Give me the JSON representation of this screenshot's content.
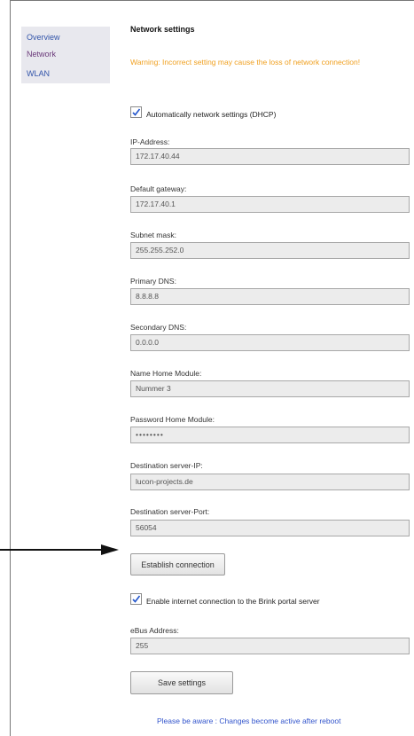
{
  "sidebar": {
    "items": [
      {
        "label": "Overview"
      },
      {
        "label": "Network"
      },
      {
        "label": "WLAN"
      }
    ]
  },
  "page": {
    "title": "Network settings",
    "warning": "Warning: Incorrect setting may cause the loss of network connection!"
  },
  "dhcp": {
    "label": "Automatically network settings (DHCP)",
    "checked": true
  },
  "fields": {
    "ip": {
      "label": "IP-Address:",
      "value": "172.17.40.44"
    },
    "gateway": {
      "label": "Default gateway:",
      "value": "172.17.40.1"
    },
    "subnet": {
      "label": "Subnet mask:",
      "value": "255.255.252.0"
    },
    "dns1": {
      "label": "Primary DNS:",
      "value": "8.8.8.8"
    },
    "dns2": {
      "label": "Secondary DNS:",
      "value": "0.0.0.0"
    },
    "module_name": {
      "label": "Name Home Module:",
      "value": "Nummer 3"
    },
    "module_password": {
      "label": "Password Home Module:",
      "value": "••••••••"
    },
    "dest_ip": {
      "label": "Destination server-IP:",
      "value": "lucon-projects.de"
    },
    "dest_port": {
      "label": "Destination server-Port:",
      "value": "56054"
    },
    "ebus": {
      "label": "eBus Address:",
      "value": "255"
    }
  },
  "buttons": {
    "connect": "Establish connection",
    "save": "Save settings"
  },
  "portal": {
    "label": "Enable internet connection to the Brink portal server",
    "checked": true
  },
  "footer": {
    "notice": "Please be aware : Changes become active after reboot"
  },
  "colors": {
    "warning": "#f0a020",
    "link": "#3355aa",
    "active": "#6b3a7a",
    "checkmark": "#2255cc"
  }
}
